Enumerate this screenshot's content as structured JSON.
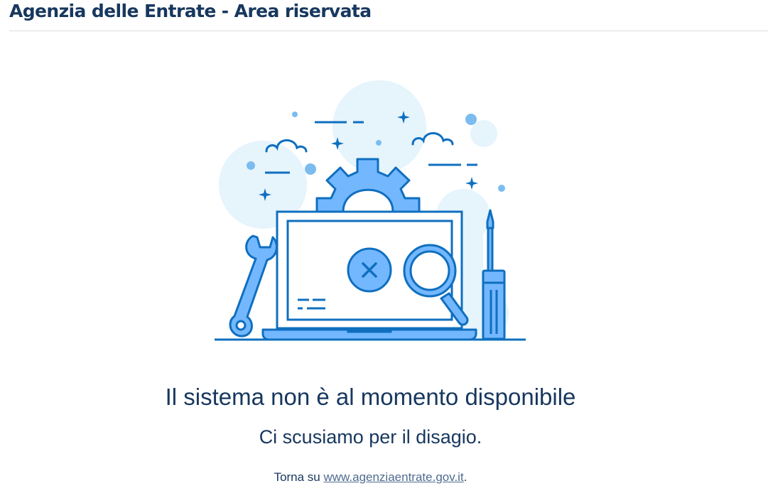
{
  "header": {
    "title": "Agenzia delle Entrate - Area riservata"
  },
  "illustration": {
    "icon": "maintenance-illustration",
    "colors": {
      "stroke": "#0f6fbf",
      "fill_light": "#73b7ff",
      "fill_background": "#e6f4fc",
      "dot": "#7bbcf0"
    }
  },
  "message": {
    "title": "Il sistema non è al momento disponibile",
    "subtitle": "Ci scusiamo per il disagio.",
    "back_prefix": "Torna su",
    "back_link_text": "www.agenziaentrate.gov.it",
    "back_suffix": "."
  },
  "colors": {
    "text": "#17375e",
    "link": "#4f6c8f",
    "divider": "#dcdcdc"
  }
}
